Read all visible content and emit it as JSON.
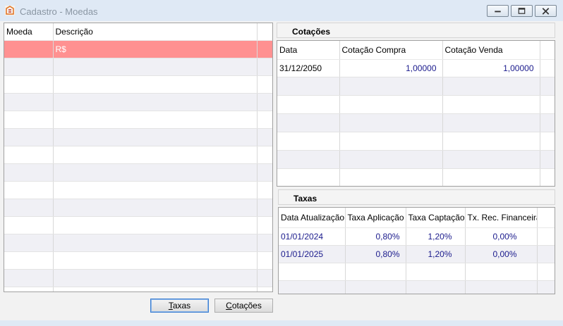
{
  "window": {
    "title": "Cadastro - Moedas",
    "min_label": "minimize",
    "max_label": "restore",
    "close_label": "close"
  },
  "moedas": {
    "headers": [
      "Moeda",
      "Descrição",
      ""
    ],
    "rows": [
      [
        "",
        "R$",
        ""
      ]
    ]
  },
  "cotacoes": {
    "title": "Cotações",
    "headers": [
      "Data",
      "Cotação Compra",
      "Cotação Venda",
      ""
    ],
    "rows": [
      [
        "31/12/2050",
        "1,00000",
        "1,00000",
        ""
      ]
    ]
  },
  "taxas": {
    "title": "Taxas",
    "headers": [
      "Data Atualização",
      "Taxa Aplicação",
      "Taxa Captação",
      "Tx. Rec. Financeira",
      ""
    ],
    "rows": [
      [
        "01/01/2024",
        "0,80%",
        "1,20%",
        "0,00%",
        ""
      ],
      [
        "01/01/2025",
        "0,80%",
        "1,20%",
        "0,00%",
        ""
      ]
    ]
  },
  "buttons": {
    "taxas_first": "T",
    "taxas_rest": "axas",
    "cotacoes_first": "C",
    "cotacoes_rest": "otações"
  },
  "colors": {
    "selected_row": "#ff9191",
    "accent": "#3c7fd1",
    "value_text": "#1a1a8c"
  }
}
